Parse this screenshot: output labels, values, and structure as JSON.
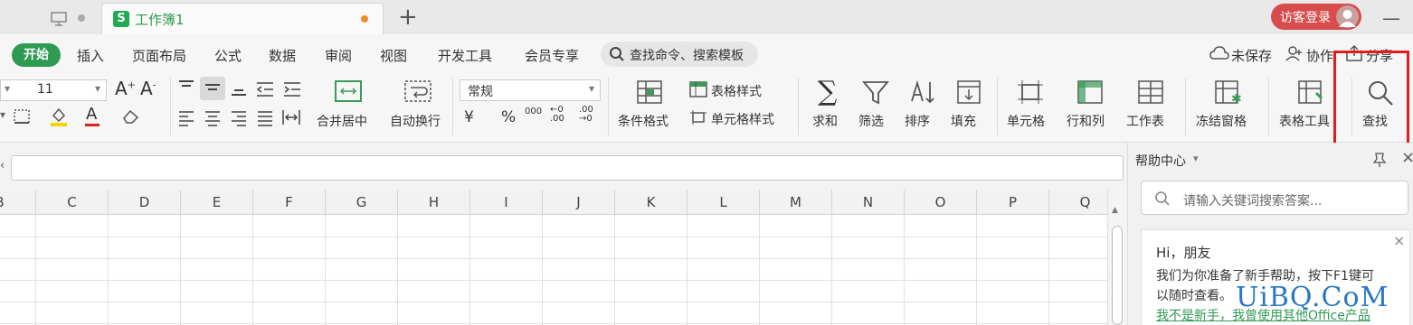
{
  "titlebar": {
    "tab_title": "工作簿1",
    "tab_icon": "S",
    "login_label": "访客登录",
    "minimize": "—"
  },
  "menu": {
    "items": [
      "开始",
      "插入",
      "页面布局",
      "公式",
      "数据",
      "审阅",
      "视图",
      "开发工具",
      "会员专享"
    ],
    "search_label": "查找命令、搜索模板",
    "unsaved": "未保存",
    "collab": "协作",
    "share": "分享"
  },
  "ribbon": {
    "font_size": "11",
    "number_format": "常规",
    "merge_label": "合并居中",
    "wrap_label": "自动换行",
    "table_style": "表格样式",
    "cell_style": "单元格样式",
    "cond_format": "条件格式",
    "sum": "求和",
    "filter": "筛选",
    "sort": "排序",
    "fill": "填充",
    "cell": "单元格",
    "rowcol": "行和列",
    "sheet": "工作表",
    "freeze": "冻结窗格",
    "table_tools": "表格工具",
    "find": "查找",
    "currency": "¥",
    "percent": "%",
    "thousands": "000"
  },
  "grid": {
    "columns": [
      "B",
      "C",
      "D",
      "E",
      "F",
      "G",
      "H",
      "I",
      "J",
      "K",
      "L",
      "M",
      "N",
      "O",
      "P",
      "Q"
    ]
  },
  "help": {
    "title": "帮助中心",
    "search_placeholder": "请输入关键词搜索答案...",
    "greeting": "Hi，朋友",
    "line1": "我们为你准备了新手帮助，按下F1键可",
    "line2": "以随时查看。",
    "link": "我不是新手，我曾使用其他Office产品"
  },
  "watermark": "UiBQ.CoM",
  "colors": {
    "accent": "#2f9a52",
    "highlight": "#e21c1c",
    "login": "#d94c4c"
  }
}
